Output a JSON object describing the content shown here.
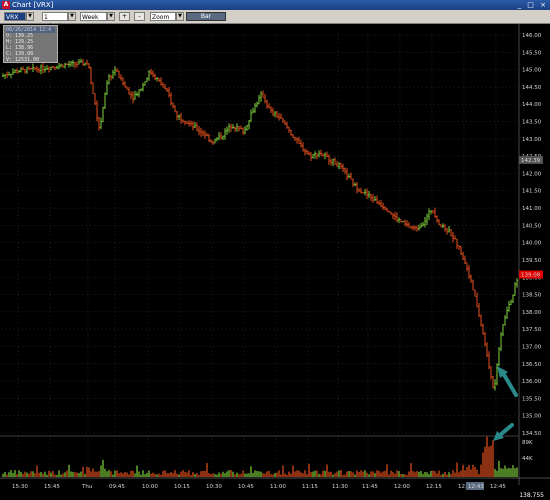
{
  "window": {
    "title": "Chart [VRX]",
    "controls": "_ □ ×"
  },
  "toolbar": {
    "symbol": "VRX",
    "interval": "1 minute",
    "range": "Week",
    "zoom_in": "+",
    "zoom_out": "-",
    "zoom_label": "Zoom",
    "bar_button": "Bar"
  },
  "info_box": {
    "header": "08/26/2014 12:4",
    "lines": [
      "O: 139.25",
      "H: 139.25",
      "L: 138.96",
      "C: 139.08",
      "V: 12531.00"
    ]
  },
  "price_axis": {
    "ticks": [
      "146.00",
      "145.50",
      "145.00",
      "144.50",
      "144.00",
      "143.50",
      "143.00",
      "142.50",
      "142.00",
      "141.50",
      "141.00",
      "140.50",
      "140.00",
      "139.50",
      "139.00",
      "138.50",
      "138.00",
      "137.50",
      "137.00",
      "136.50",
      "136.00",
      "135.50",
      "135.00",
      "134.50"
    ],
    "current_price": "139.08",
    "mid_marker": "142.39"
  },
  "volume_axis": {
    "ticks": [
      "89K",
      "44K"
    ]
  },
  "time_axis": {
    "ticks": [
      "15:30",
      "15:45",
      "Thu",
      "09:45",
      "10:00",
      "10:15",
      "10:30",
      "10:45",
      "11:00",
      "11:15",
      "11:30",
      "11:45",
      "12:00",
      "12:15",
      "12:30",
      "12:45"
    ],
    "cursor_time": "12:43"
  },
  "bottom_readout": "138.755",
  "colors": {
    "up": "#7fd13b",
    "down": "#e8501e",
    "teal_arrow": "#2a8a8a",
    "price_flag": "#e00000"
  },
  "chart_data": {
    "type": "bar",
    "title": "",
    "interval": "1 minute",
    "x_labels": [
      "15:30",
      "15:45",
      "Thu",
      "09:45",
      "10:00",
      "10:15",
      "10:30",
      "10:45",
      "11:00",
      "11:15",
      "11:30",
      "11:45",
      "12:00",
      "12:15",
      "12:30",
      "12:45"
    ],
    "ylim": [
      134.5,
      146.0
    ],
    "close_path": [
      [
        0,
        144.8
      ],
      [
        15,
        144.95
      ],
      [
        30,
        145.0
      ],
      [
        45,
        145.05
      ],
      [
        55,
        145.1
      ],
      [
        70,
        145.15
      ],
      [
        88,
        145.2
      ],
      [
        96,
        143.8
      ],
      [
        100,
        143.2
      ],
      [
        104,
        144.2
      ],
      [
        108,
        144.7
      ],
      [
        115,
        145.0
      ],
      [
        125,
        144.5
      ],
      [
        133,
        144.2
      ],
      [
        142,
        144.5
      ],
      [
        150,
        144.95
      ],
      [
        158,
        144.7
      ],
      [
        168,
        144.3
      ],
      [
        176,
        143.7
      ],
      [
        186,
        143.5
      ],
      [
        196,
        143.3
      ],
      [
        206,
        143.1
      ],
      [
        212,
        142.9
      ],
      [
        222,
        143.1
      ],
      [
        232,
        143.4
      ],
      [
        244,
        143.2
      ],
      [
        252,
        143.8
      ],
      [
        262,
        144.3
      ],
      [
        270,
        143.8
      ],
      [
        280,
        143.6
      ],
      [
        290,
        143.2
      ],
      [
        300,
        142.8
      ],
      [
        310,
        142.5
      ],
      [
        320,
        142.6
      ],
      [
        330,
        142.4
      ],
      [
        340,
        142.2
      ],
      [
        348,
        141.9
      ],
      [
        356,
        141.6
      ],
      [
        366,
        141.4
      ],
      [
        376,
        141.2
      ],
      [
        386,
        141.0
      ],
      [
        396,
        140.7
      ],
      [
        406,
        140.5
      ],
      [
        416,
        140.4
      ],
      [
        424,
        140.6
      ],
      [
        432,
        141.0
      ],
      [
        440,
        140.5
      ],
      [
        450,
        140.3
      ],
      [
        460,
        139.8
      ],
      [
        468,
        139.2
      ],
      [
        476,
        138.3
      ],
      [
        484,
        137.2
      ],
      [
        490,
        136.3
      ],
      [
        494,
        135.7
      ],
      [
        498,
        136.8
      ],
      [
        504,
        137.8
      ],
      [
        512,
        138.4
      ],
      [
        518,
        139.08
      ]
    ],
    "volume_peak_time": "12:40"
  }
}
